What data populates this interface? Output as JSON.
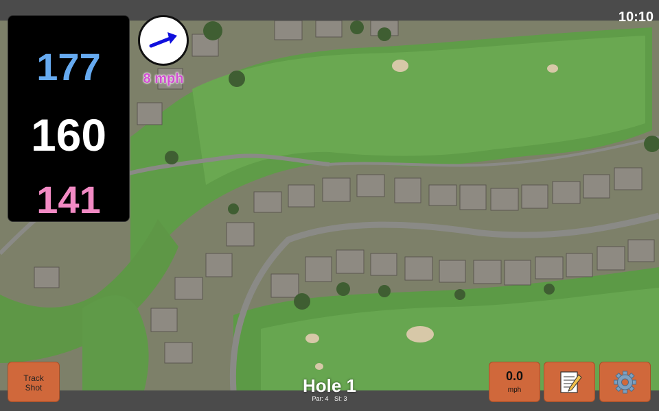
{
  "status": {
    "time": "10:10"
  },
  "distances": {
    "back": "177",
    "middle": "160",
    "front": "141"
  },
  "wind": {
    "speed_label": "8 mph",
    "arrow_icon": "arrow-right-icon"
  },
  "hole": {
    "title": "Hole 1",
    "par": "Par: 4",
    "si": "SI: 3"
  },
  "buttons": {
    "track_shot_line1": "Track",
    "track_shot_line2": "Shot",
    "speed_value": "0.0",
    "speed_unit": "mph",
    "notes_icon": "notepad-icon",
    "settings_icon": "gear-icon"
  },
  "colors": {
    "back": "#66aaf0",
    "middle": "#ffffff",
    "front": "#f28ac4",
    "button": "#d0683b",
    "wind_text": "#d04fd0"
  }
}
